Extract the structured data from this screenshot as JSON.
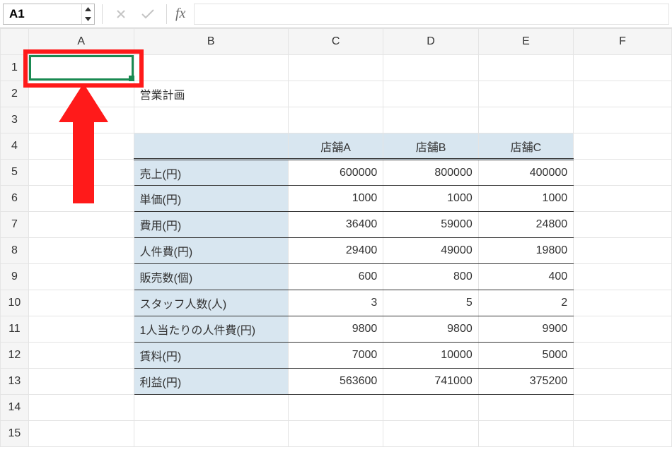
{
  "name_box": "A1",
  "fx_label": "fx",
  "formula_value": "",
  "columns": [
    "A",
    "B",
    "C",
    "D",
    "E",
    "F"
  ],
  "rows": [
    "1",
    "2",
    "3",
    "4",
    "5",
    "6",
    "7",
    "8",
    "9",
    "10",
    "11",
    "12",
    "13",
    "14",
    "15"
  ],
  "title": "営業計画",
  "header": {
    "c": "店舗A",
    "d": "店舗B",
    "e": "店舗C"
  },
  "rowsData": {
    "r5": {
      "label": "売上(円)",
      "c": "600000",
      "d": "800000",
      "e": "400000"
    },
    "r6": {
      "label": "単価(円)",
      "c": "1000",
      "d": "1000",
      "e": "1000"
    },
    "r7": {
      "label": "費用(円)",
      "c": "36400",
      "d": "59000",
      "e": "24800"
    },
    "r8": {
      "label": "人件費(円)",
      "c": "29400",
      "d": "49000",
      "e": "19800"
    },
    "r9": {
      "label": "販売数(個)",
      "c": "600",
      "d": "800",
      "e": "400"
    },
    "r10": {
      "label": "スタッフ人数(人)",
      "c": "3",
      "d": "5",
      "e": "2"
    },
    "r11": {
      "label": "1人当たりの人件費(円)",
      "c": "9800",
      "d": "9800",
      "e": "9900"
    },
    "r12": {
      "label": "賃料(円)",
      "c": "7000",
      "d": "10000",
      "e": "5000"
    },
    "r13": {
      "label": "利益(円)",
      "c": "563600",
      "d": "741000",
      "e": "375200"
    }
  }
}
